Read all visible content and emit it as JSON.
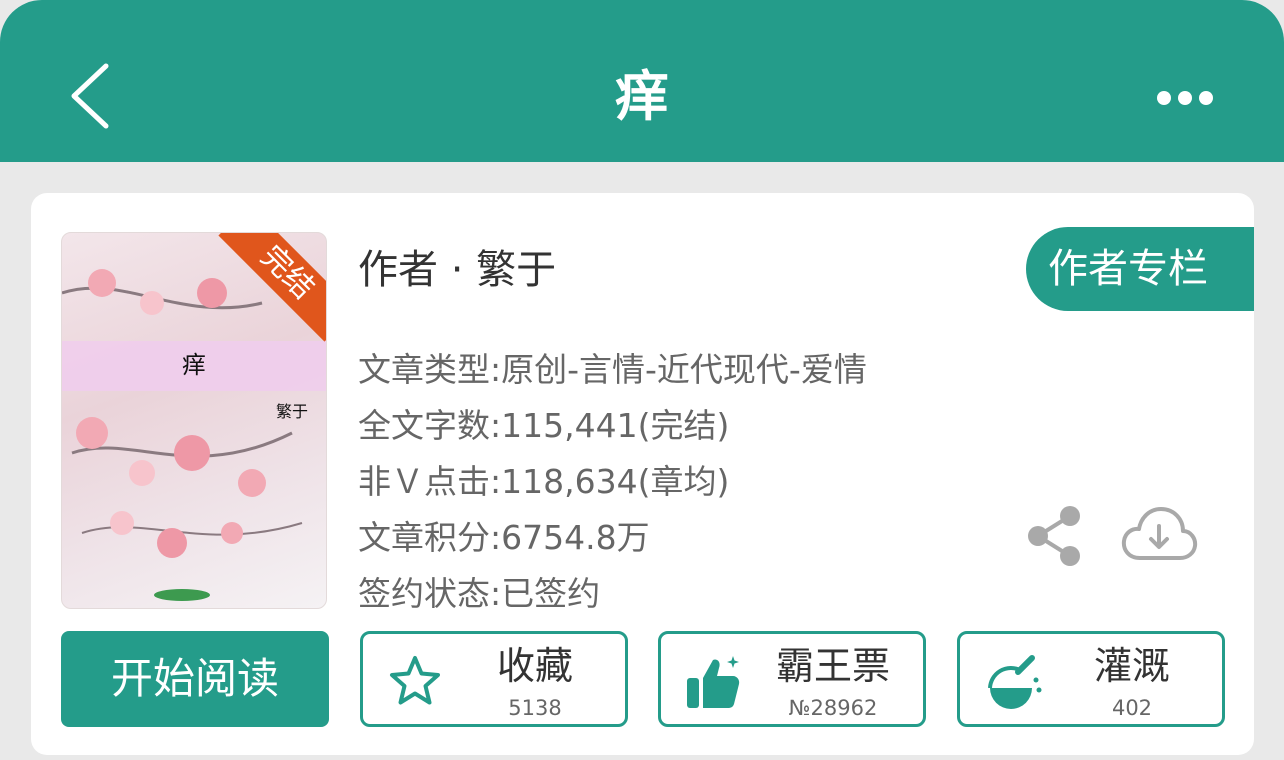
{
  "header": {
    "title": "痒",
    "back_icon": "chevron-left-icon",
    "more_icon": "more-dots-icon"
  },
  "cover": {
    "title": "痒",
    "author": "繁于",
    "ribbon": "完结"
  },
  "author": {
    "line": "作者 · 繁于",
    "column_button": "作者专栏"
  },
  "info": {
    "type": "文章类型:原创-言情-近代现代-爱情",
    "words": "全文字数:115,441(完结)",
    "clicks": "非Ｖ点击:118,634(章均)",
    "score": "文章积分:6754.8万",
    "sign": "签约状态:已签约"
  },
  "actions": {
    "read": "开始阅读",
    "favorite": {
      "label": "收藏",
      "count": "5138",
      "icon": "star-icon"
    },
    "ticket": {
      "label": "霸王票",
      "count": "№28962",
      "icon": "thumbs-up-icon"
    },
    "water": {
      "label": "灌溉",
      "count": "402",
      "icon": "watering-flask-icon"
    }
  },
  "icons": {
    "share": "share-icon",
    "download": "cloud-download-icon"
  },
  "colors": {
    "accent": "#249c8a",
    "ribbon": "#e0561c",
    "icon_gray": "#a9a9a9"
  }
}
